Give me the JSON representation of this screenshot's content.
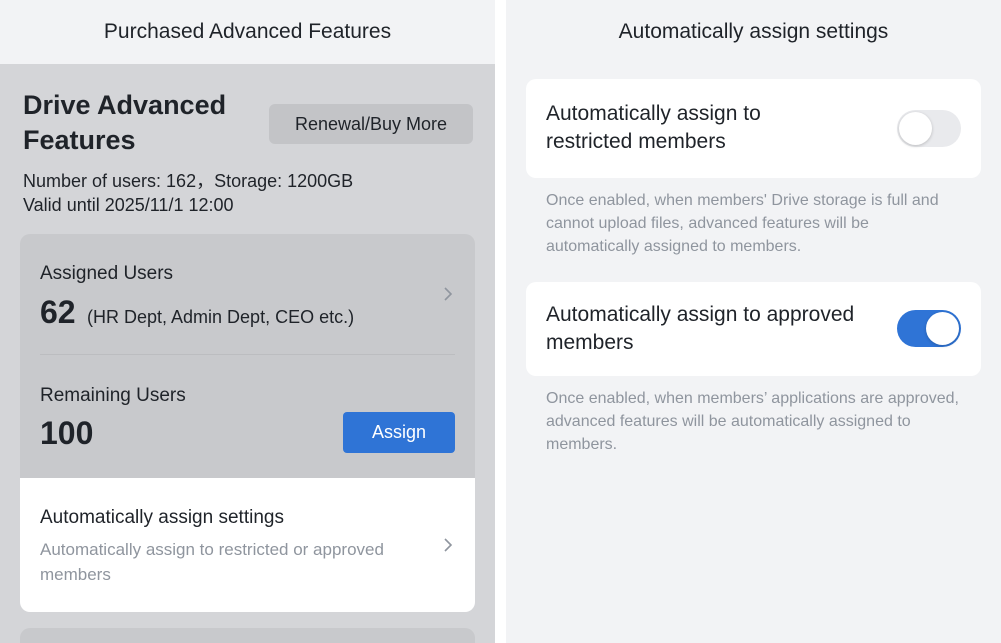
{
  "left": {
    "nav_title": "Purchased Advanced Features",
    "product_title": "Drive Advanced Features",
    "renew_button": "Renewal/Buy More",
    "meta_users_storage": "Number of users: 162，Storage: 1200GB",
    "meta_valid_until": "Valid until 2025/11/1 12:00",
    "assigned": {
      "label": "Assigned Users",
      "count": "62",
      "departments": "(HR Dept, Admin Dept, CEO etc.)"
    },
    "remaining": {
      "label": "Remaining Users",
      "count": "100",
      "assign_button": "Assign"
    },
    "auto_assign": {
      "title": "Automatically assign settings",
      "subtitle": "Automatically assign to restricted or approved members"
    }
  },
  "right": {
    "nav_title": "Automatically assign settings",
    "restricted": {
      "label": "Automatically assign to restricted members",
      "enabled": false,
      "hint": "Once enabled, when members' Drive storage is full and cannot upload files, advanced features will be automatically assigned to members."
    },
    "approved": {
      "label": "Automatically assign to approved members",
      "enabled": true,
      "hint": "Once enabled, when members’ applications are approved, advanced features will be automatically assigned to members."
    }
  },
  "colors": {
    "accent": "#2f74d6",
    "left_background": "#d4d5d8",
    "right_background": "#f2f3f5",
    "muted_text": "#8f959e"
  },
  "icons": [
    "chevron-right-icon",
    "chevron-right-icon"
  ]
}
